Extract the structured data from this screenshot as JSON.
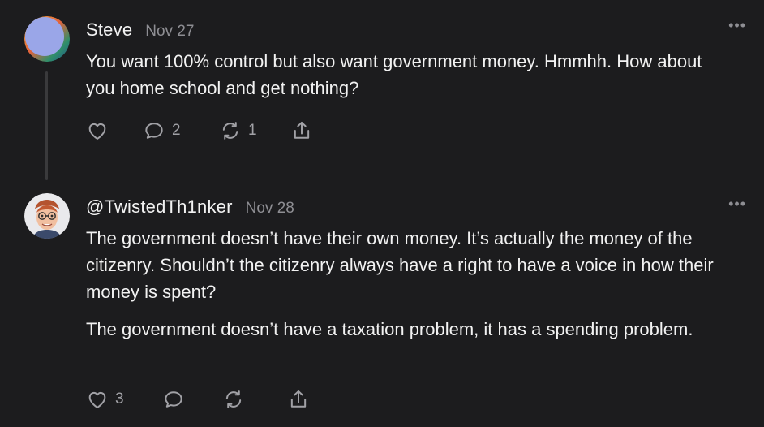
{
  "posts": [
    {
      "author": "Steve",
      "date": "Nov 27",
      "paragraphs": [
        "You want 100% control but also want government money. Hmmhh. How about you home school and get nothing?"
      ],
      "actions": {
        "like_count": "",
        "comment_count": "2",
        "restack_count": "1"
      }
    },
    {
      "author": "@TwistedTh1nker",
      "date": "Nov 28",
      "paragraphs": [
        "The government doesn’t have their own money. It’s actually the money of the citizenry. Shouldn’t the citizenry always have a right to have a voice in how their money is spent?",
        "The government doesn’t have a taxation problem, it has a spending problem."
      ],
      "actions": {
        "like_count": "3",
        "comment_count": "",
        "restack_count": ""
      }
    }
  ],
  "icons": {
    "like": "heart-icon",
    "comment": "comment-bubble-icon",
    "restack": "restack-arrows-icon",
    "share": "share-upload-icon",
    "more": "more-dots-icon"
  },
  "colors": {
    "background": "#1c1c1e",
    "text": "#f2f2f2",
    "muted": "#8e8e93",
    "thread_line": "#3a3a3c"
  }
}
